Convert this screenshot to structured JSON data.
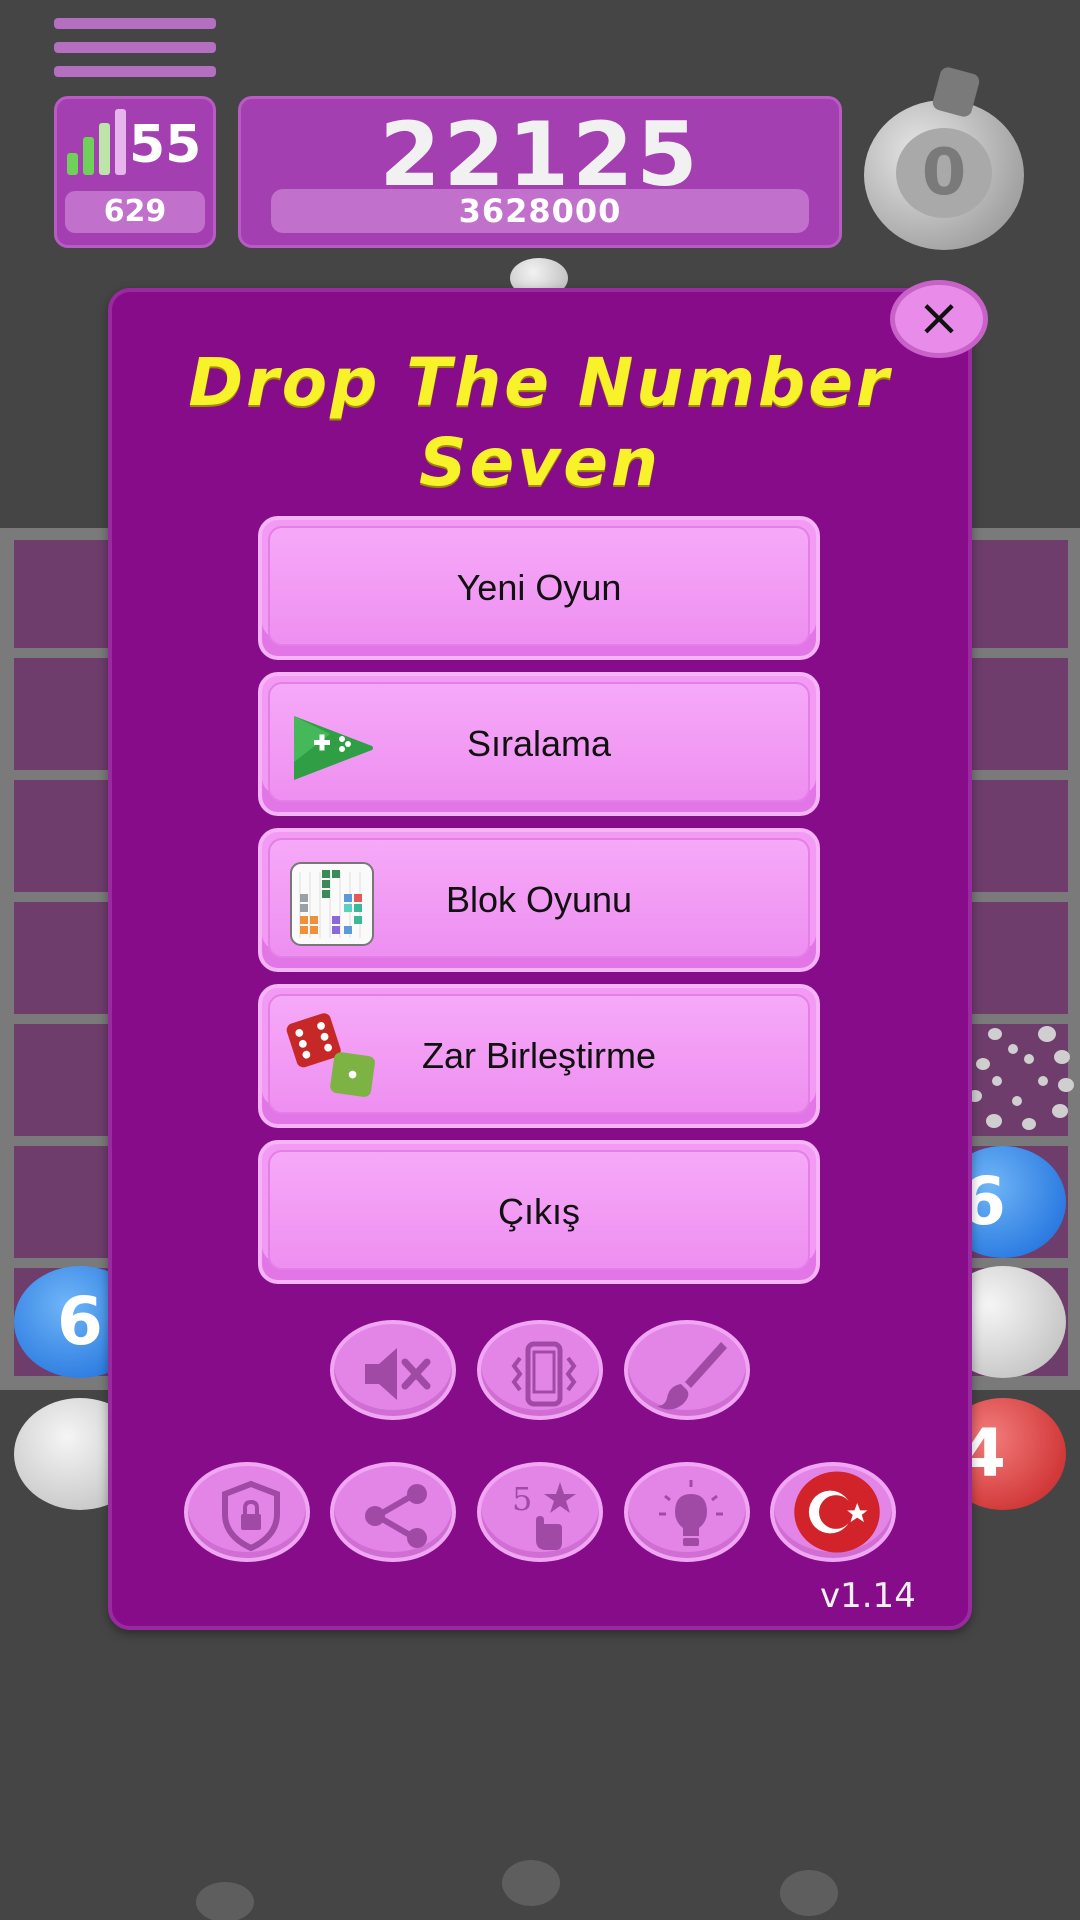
{
  "hud": {
    "level": "55",
    "level_progress": "629",
    "score": "22125",
    "best_score": "3628000",
    "bomb_count": "0"
  },
  "board": {
    "balls": [
      {
        "value": "6",
        "color": "blue"
      },
      {
        "value": "6",
        "color": "blue"
      },
      {
        "value": "4",
        "color": "red"
      }
    ]
  },
  "dialog": {
    "title_line1": "Drop The Number",
    "title_line2": "Seven",
    "close_label": "×",
    "buttons": {
      "new_game": "Yeni Oyun",
      "leaderboard": "Sıralama",
      "block_game": "Blok Oyunu",
      "dice_merge": "Zar Birleştirme",
      "exit": "Çıkış"
    },
    "icons_row1": [
      "sound-off-icon",
      "vibration-icon",
      "theme-brush-icon"
    ],
    "icons_row2": [
      "privacy-shield-icon",
      "share-icon",
      "rate-5-star-icon",
      "hint-bulb-icon",
      "turkish-flag-icon"
    ],
    "version": "v1.14"
  },
  "colors": {
    "background": "#454545",
    "dialog": "#860c8a",
    "title": "#f8f22b",
    "button": "#f39af5"
  }
}
